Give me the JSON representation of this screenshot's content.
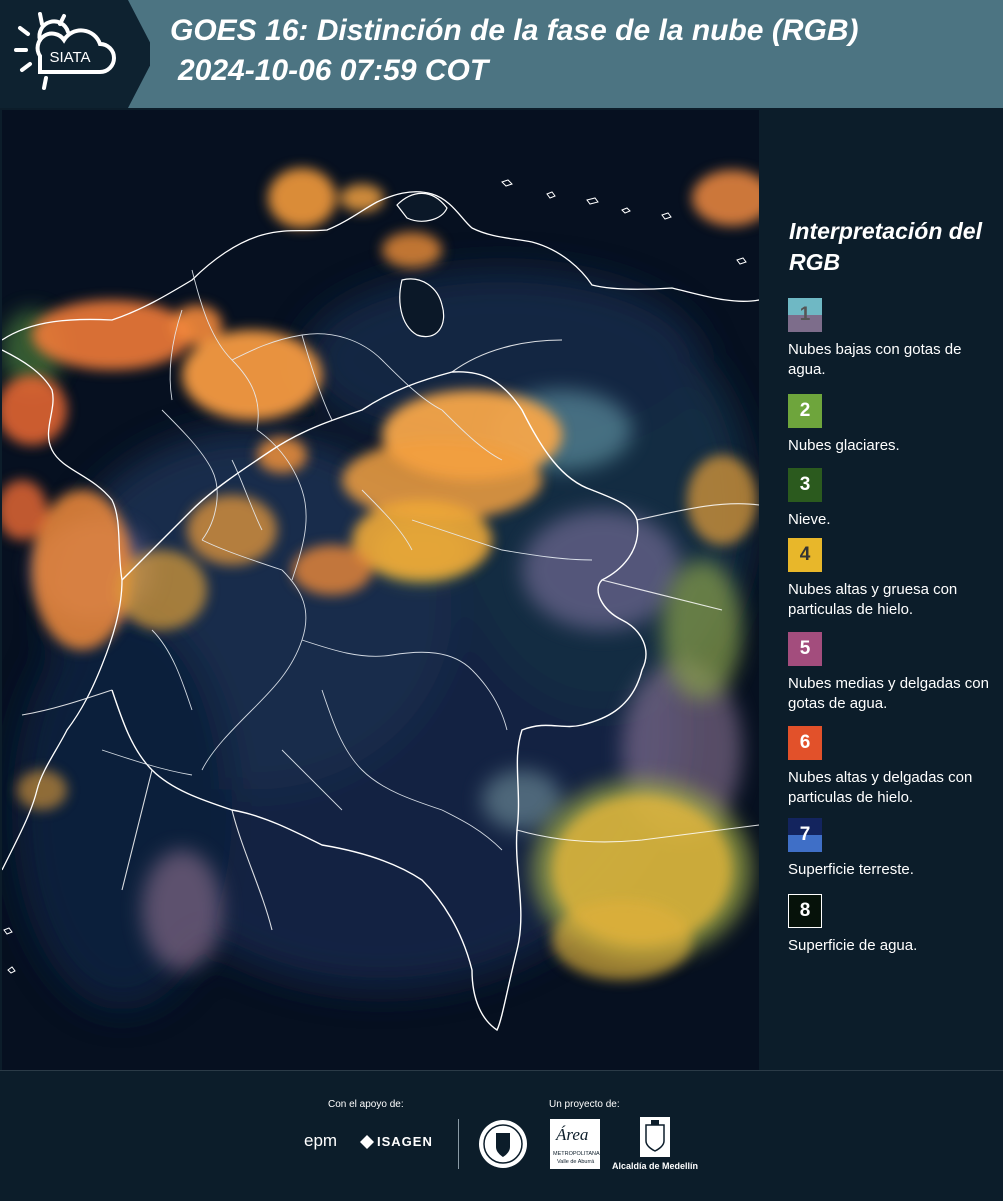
{
  "header": {
    "logo_text": "SIATA",
    "title_line1": "GOES 16: Distinción de la fase de la nube (RGB)",
    "title_line2": "2024-10-06 07:59 COT"
  },
  "map": {
    "layer": "satellite-rgb-cloud-phase",
    "region": "Colombia"
  },
  "legend": {
    "title": "Interpretación del RGB",
    "items": [
      {
        "num": "1",
        "label": "Nubes bajas con gotas de agua.",
        "color_top": "#6fb8c4",
        "color_bottom": "#7d6d8b",
        "num_color": "#555555"
      },
      {
        "num": "2",
        "label": "Nubes glaciares.",
        "color_top": "#6ea53c",
        "color_bottom": "#6ea53c",
        "num_color": "#ffffff"
      },
      {
        "num": "3",
        "label": "Nieve.",
        "color_top": "#2b5a1e",
        "color_bottom": "#2b5a1e",
        "num_color": "#ffffff"
      },
      {
        "num": "4",
        "label": "Nubes altas y gruesa con particulas de hielo.",
        "color_top": "#e8b72a",
        "color_bottom": "#e8b72a",
        "num_color": "#333333"
      },
      {
        "num": "5",
        "label": "Nubes medias y delgadas con gotas de agua.",
        "color_top": "#a34d7d",
        "color_bottom": "#a34d7d",
        "num_color": "#ffffff"
      },
      {
        "num": "6",
        "label": "Nubes altas y delgadas con particulas de hielo.",
        "color_top": "#e2512a",
        "color_bottom": "#e2512a",
        "num_color": "#ffffff"
      },
      {
        "num": "7",
        "label": "Superficie terreste.",
        "color_top": "#13245e",
        "color_bottom": "#3f6fc7",
        "num_color": "#ffffff"
      },
      {
        "num": "8",
        "label": "Superficie de agua.",
        "color_top": "#06120a",
        "color_bottom": "#06120a",
        "num_color": "#ffffff"
      }
    ]
  },
  "footer": {
    "support_label": "Con el apoyo de:",
    "project_label": "Un proyecto de:",
    "sponsor1": "epm",
    "sponsor2": "ISAGEN",
    "partner1": "Área",
    "partner1_sub1": "METROPOLITANA",
    "partner1_sub2": "Valle de Aburrá",
    "partner2": "Alcaldía de Medellín"
  }
}
